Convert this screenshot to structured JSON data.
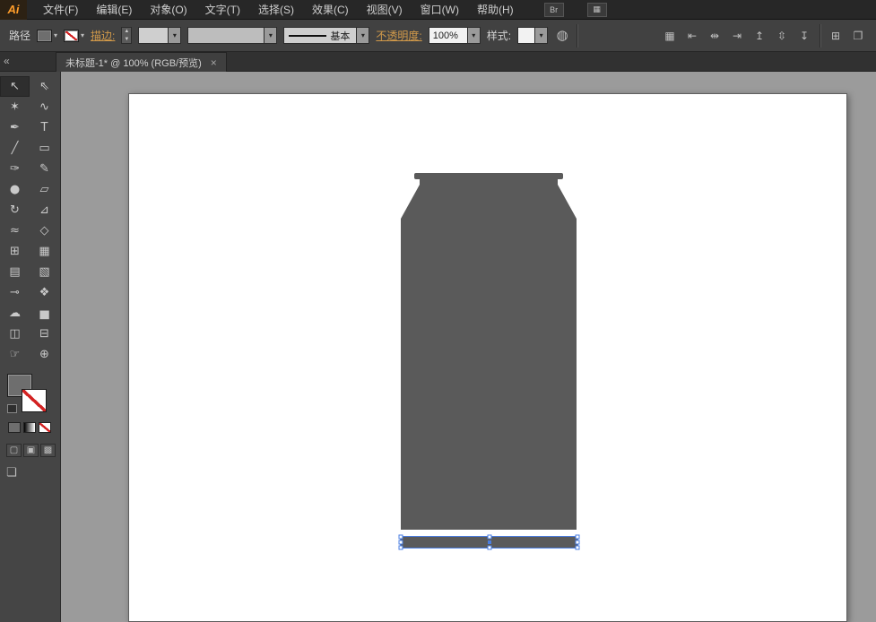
{
  "app": {
    "logo": "Ai",
    "menus": [
      "文件(F)",
      "编辑(E)",
      "对象(O)",
      "文字(T)",
      "选择(S)",
      "效果(C)",
      "视图(V)",
      "窗口(W)",
      "帮助(H)"
    ],
    "icons": [
      {
        "name": "bridge-icon",
        "glyph": "Br"
      },
      {
        "name": "arrange-documents-icon",
        "glyph": "▦"
      }
    ]
  },
  "controlbar": {
    "selection_type": "路径",
    "stroke_label": "描边:",
    "brush_name": "基本",
    "opacity_label": "不透明度:",
    "opacity_value": "100%",
    "style_label": "样式:",
    "recolor_glyph": "◍",
    "align_icons": [
      {
        "name": "align-options-icon",
        "glyph": "▦"
      },
      {
        "name": "align-horizontal-left-icon",
        "glyph": "⇤"
      },
      {
        "name": "align-horizontal-center-icon",
        "glyph": "⇹"
      },
      {
        "name": "align-horizontal-right-icon",
        "glyph": "⇥"
      },
      {
        "name": "align-vertical-top-icon",
        "glyph": "↥"
      },
      {
        "name": "align-vertical-center-icon",
        "glyph": "⇳"
      },
      {
        "name": "align-vertical-bottom-icon",
        "glyph": "↧"
      }
    ],
    "right_icons": [
      {
        "name": "transform-panel-icon",
        "glyph": "⊞"
      },
      {
        "name": "arrange-icon",
        "glyph": "❐"
      }
    ]
  },
  "document_tab": {
    "title": "未标题-1* @ 100% (RGB/预览)",
    "close": "×"
  },
  "toolbar": {
    "collapse": "«",
    "tools": [
      {
        "name": "selection-tool",
        "glyph": "↖"
      },
      {
        "name": "direct-selection-tool",
        "glyph": "⇖"
      },
      {
        "name": "magic-wand-tool",
        "glyph": "✶"
      },
      {
        "name": "lasso-tool",
        "glyph": "∿"
      },
      {
        "name": "pen-tool",
        "glyph": "✒"
      },
      {
        "name": "type-tool",
        "glyph": "T"
      },
      {
        "name": "line-segment-tool",
        "glyph": "╱"
      },
      {
        "name": "rectangle-tool",
        "glyph": "▭"
      },
      {
        "name": "paintbrush-tool",
        "glyph": "✑"
      },
      {
        "name": "pencil-tool",
        "glyph": "✎"
      },
      {
        "name": "blob-brush-tool",
        "glyph": "●"
      },
      {
        "name": "eraser-tool",
        "glyph": "▱"
      },
      {
        "name": "rotate-tool",
        "glyph": "↻"
      },
      {
        "name": "scale-tool",
        "glyph": "⊿"
      },
      {
        "name": "width-tool",
        "glyph": "≈"
      },
      {
        "name": "free-transform-tool",
        "glyph": "◇"
      },
      {
        "name": "shape-builder-tool",
        "glyph": "⊞"
      },
      {
        "name": "perspective-grid-tool",
        "glyph": "▦"
      },
      {
        "name": "mesh-tool",
        "glyph": "▤"
      },
      {
        "name": "gradient-tool",
        "glyph": "▧"
      },
      {
        "name": "eyedropper-tool",
        "glyph": "⊸"
      },
      {
        "name": "blend-tool",
        "glyph": "❖"
      },
      {
        "name": "symbol-sprayer-tool",
        "glyph": "☁"
      },
      {
        "name": "column-graph-tool",
        "glyph": "▅"
      },
      {
        "name": "artboard-tool",
        "glyph": "◫"
      },
      {
        "name": "slice-tool",
        "glyph": "⊟"
      },
      {
        "name": "hand-tool",
        "glyph": "☞"
      },
      {
        "name": "zoom-tool",
        "glyph": "⊕"
      }
    ],
    "draw_modes": [
      {
        "name": "draw-normal-mode-button",
        "glyph": "▢"
      },
      {
        "name": "draw-behind-mode-button",
        "glyph": "▣"
      },
      {
        "name": "draw-inside-mode-button",
        "glyph": "▩"
      }
    ],
    "screen_mode_glyph": "❏"
  },
  "canvas": {
    "shape_color": "#5a5a5a",
    "artboard_color": "#ffffff"
  },
  "colors": {
    "selection_blue": "#4a7de0",
    "shape_gray": "#5a5a5a",
    "link_orange": "#d29a4a",
    "logo_orange": "#ff9d2a"
  }
}
